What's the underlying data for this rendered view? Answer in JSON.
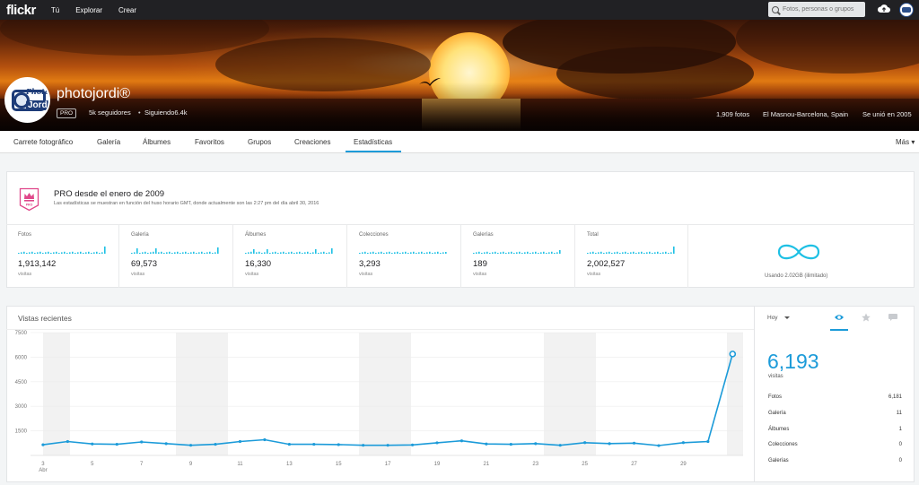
{
  "topnav": {
    "logo": "flickr",
    "links": [
      "Tú",
      "Explorar",
      "Crear"
    ],
    "search_placeholder": "Fotos, personas o grupos",
    "icons": [
      "search-icon",
      "cloud-upload-icon",
      "avatar"
    ]
  },
  "profile": {
    "name": "photojordi®",
    "badge": "PRO",
    "followers": "5k seguidores",
    "separator": "•",
    "following": "Siguiendo6.4k",
    "photos": "1,909 fotos",
    "location": "El Masnou-Barcelona, Spain",
    "joined": "Se unió en 2005",
    "avatar_text_1": "Photo",
    "avatar_text_2": "Jordi"
  },
  "subnav": {
    "tabs": [
      "Carrete fotográfico",
      "Galería",
      "Álbumes",
      "Favoritos",
      "Grupos",
      "Creaciones",
      "Estadísticas"
    ],
    "active": "Estadísticas",
    "more": "Más ▾"
  },
  "pro_card": {
    "title": "PRO desde el enero de 2009",
    "subtitle": "Las estadísticas se muestran en función del huso horario GMT, donde actualmente son las 2:27 pm del día abril 30, 2016",
    "crown_label": "PRO",
    "stats": [
      {
        "label": "Fotos",
        "value": "1,913,142",
        "unit": "visitas"
      },
      {
        "label": "Galería",
        "value": "69,573",
        "unit": "visitas"
      },
      {
        "label": "Álbumes",
        "value": "16,330",
        "unit": "visitas"
      },
      {
        "label": "Colecciones",
        "value": "3,293",
        "unit": "visitas"
      },
      {
        "label": "Galerías",
        "value": "189",
        "unit": "visitas"
      },
      {
        "label": "Total",
        "value": "2,002,527",
        "unit": "visitas"
      }
    ],
    "storage": "Usando 2.02GB (ilimitado)"
  },
  "recent_views": {
    "title": "Vistas recientes",
    "period": "Hoy",
    "today_total": "6,193",
    "today_unit": "visitas",
    "breakdown": [
      {
        "label": "Fotos",
        "value": "6,181"
      },
      {
        "label": "Galería",
        "value": "11"
      },
      {
        "label": "Álbumes",
        "value": "1"
      },
      {
        "label": "Colecciones",
        "value": "0"
      },
      {
        "label": "Galerías",
        "value": "0"
      }
    ],
    "tab_icons": [
      "eye-icon",
      "star-icon",
      "comment-icon"
    ]
  },
  "chart_data": {
    "type": "line",
    "title": "Vistas recientes",
    "xlabel": "",
    "ylabel": "",
    "x_month_label": "Abr",
    "x": [
      3,
      4,
      5,
      6,
      7,
      8,
      9,
      10,
      11,
      12,
      13,
      14,
      15,
      16,
      17,
      18,
      19,
      20,
      21,
      22,
      23,
      24,
      25,
      26,
      27,
      28,
      29,
      30
    ],
    "x_tick_labels": [
      "3",
      "5",
      "7",
      "9",
      "11",
      "13",
      "15",
      "17",
      "19",
      "21",
      "23",
      "25",
      "27",
      "29"
    ],
    "y_ticks": [
      "7500",
      "6000",
      "4500",
      "3000",
      "1500"
    ],
    "ylim": [
      0,
      7500
    ],
    "series": [
      {
        "values": [
          650,
          850,
          700,
          680,
          820,
          720,
          620,
          680,
          850,
          960,
          680,
          680,
          660,
          620,
          620,
          640,
          770,
          890,
          700,
          680,
          720,
          620,
          780,
          720,
          750,
          600,
          780,
          850,
          6193
        ]
      }
    ],
    "highlighted_last_point": true,
    "line_color": "#1c9bd9",
    "weekend_bands": true
  }
}
